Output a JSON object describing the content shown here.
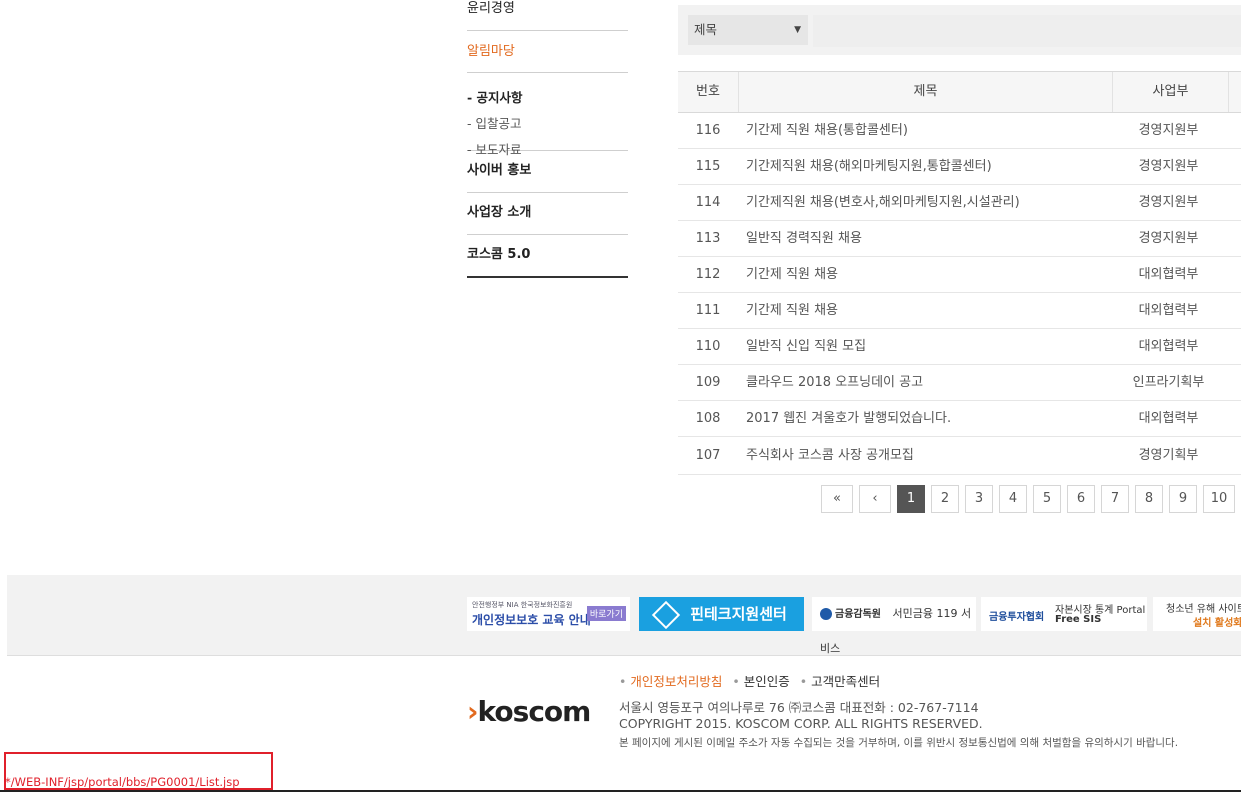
{
  "sidebar": {
    "top_item": "윤리경영",
    "active_section": "알림마당",
    "sub_items": [
      "- 공지사항",
      "- 입찰공고",
      "- 보도자료"
    ],
    "items": [
      "사이버 홍보",
      "사업장 소개",
      "코스콤 5.0"
    ]
  },
  "search": {
    "select_value": "제목",
    "input_placeholder": ""
  },
  "table": {
    "headers": {
      "no": "번호",
      "title": "제목",
      "dept": "사업부"
    },
    "rows": [
      {
        "no": "116",
        "title": "기간제 직원 채용(통합콜센터)",
        "dept": "경영지원부"
      },
      {
        "no": "115",
        "title": "기간제직원 채용(해외마케팅지원,통합콜센터)",
        "dept": "경영지원부"
      },
      {
        "no": "114",
        "title": "기간제직원 채용(변호사,해외마케팅지원,시설관리)",
        "dept": "경영지원부"
      },
      {
        "no": "113",
        "title": "일반직 경력직원 채용",
        "dept": "경영지원부"
      },
      {
        "no": "112",
        "title": "기간제 직원 채용",
        "dept": "대외협력부"
      },
      {
        "no": "111",
        "title": "기간제 직원 채용",
        "dept": "대외협력부"
      },
      {
        "no": "110",
        "title": "일반직 신입 직원 모집",
        "dept": "대외협력부"
      },
      {
        "no": "109",
        "title": "클라우드 2018 오프닝데이 공고",
        "dept": "인프라기획부"
      },
      {
        "no": "108",
        "title": "2017 웹진 겨울호가 발행되었습니다.",
        "dept": "대외협력부"
      },
      {
        "no": "107",
        "title": "주식회사 코스콤 사장 공개모집",
        "dept": "경영기획부"
      }
    ]
  },
  "pagination": {
    "first": "«",
    "prev": "‹",
    "pages": [
      "1",
      "2",
      "3",
      "4",
      "5",
      "6",
      "7",
      "8",
      "9",
      "10"
    ],
    "current": "1"
  },
  "banners": {
    "privacy_top": "안전행정부  NIA 한국정보화진흥원",
    "privacy": "개인정보보호 교육 안내",
    "privacy_btn": "바로가기",
    "fintech": "핀테크지원센터",
    "fss_org": "금융감독원",
    "fss_service": "서민금융 119 서비스",
    "kofia": "금융투자협회",
    "sis_line1": "자본시장 통계 Portal",
    "sis_line2": "Free SIS",
    "youth_line1": "청소년 유해 사이트",
    "youth_line2": "설치 활성화"
  },
  "footer": {
    "logo": "koscom",
    "links": [
      "개인정보처리방침",
      "본인인증",
      "고객만족센터"
    ],
    "address": "서울시 영등포구 여의나루로 76 ㈜코스콤 대표전화 : 02-767-7114",
    "copyright": "COPYRIGHT 2015. KOSCOM CORP. ALL RIGHTS RESERVED.",
    "notice": "본 페이지에 게시된 이메일 주소가 자동 수집되는 것을 거부하며, 이를 위반시 정보통신법에 의해 처벌함을 유의하시기 바랍니다."
  },
  "debug_path": "*/WEB-INF/jsp/portal/bbs/PG0001/List.jsp",
  "colors": {
    "accent": "#e26a1f",
    "debug": "#e0202b",
    "pager_active": "#555555"
  }
}
